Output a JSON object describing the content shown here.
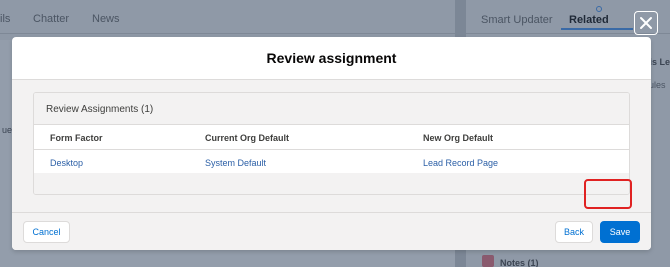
{
  "background": {
    "left_tabs": [
      "ils",
      "Chatter",
      "News"
    ],
    "right_tabs": [
      "Smart Updater",
      "Related"
    ],
    "right_snippets": [
      "nis Le",
      "rules",
      "Notes (1)"
    ],
    "left_snippet": "ue"
  },
  "modal": {
    "title": "Review assignment",
    "card_title": "Review Assignments (1)",
    "columns": [
      "Form Factor",
      "Current Org Default",
      "New Org Default"
    ],
    "rows": [
      [
        "Desktop",
        "System Default",
        "Lead Record Page"
      ]
    ],
    "buttons": {
      "cancel": "Cancel",
      "back": "Back",
      "save": "Save"
    }
  },
  "colors": {
    "brand": "#0070d2",
    "highlight": "#e02222"
  },
  "icons": {
    "close": "close-icon"
  }
}
